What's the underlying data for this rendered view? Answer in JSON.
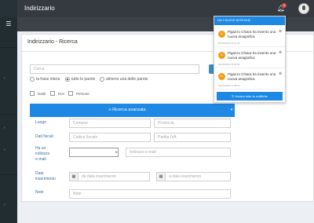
{
  "header": {
    "title": "Indirizzario",
    "bell_icon": "bell-icon",
    "bell_count": "3",
    "avatar_icon": "user-avatar"
  },
  "sidebar": {
    "menu_icon": "hamburger-icon",
    "chevrons": [
      "‹",
      "‹",
      "‹",
      "‹"
    ]
  },
  "panel": {
    "title": "Indirizzario - Ricerca",
    "search": {
      "placeholder": "Cerca"
    },
    "search_button_icon": "search-icon",
    "match_options": [
      {
        "label": "la frase intera",
        "checked": false
      },
      {
        "label": "tutte le parole",
        "checked": true
      },
      {
        "label": "almeno una delle parole",
        "checked": false
      }
    ],
    "checkboxes": [
      {
        "label": "Datiti",
        "checked": false
      },
      {
        "label": "Enti",
        "checked": false
      },
      {
        "label": "Persone",
        "checked": false
      }
    ],
    "advanced": {
      "label": "≡ Ricerca avanzata",
      "caret": "▾"
    }
  },
  "advanced_form": {
    "luogo": {
      "label": "Luogo",
      "comune_placeholder": "Comune",
      "provincia_placeholder": "Provincia"
    },
    "dati_fiscali": {
      "label": "Dati fiscali",
      "cf_placeholder": "Codice fiscale",
      "piva_placeholder": "Partita IVA"
    },
    "email": {
      "label_lines": [
        "Ha un",
        "indirizzo",
        "e-mail"
      ],
      "placeholder": "Indirizzo e-mail"
    },
    "data_inserimento": {
      "label_lines": [
        "Data",
        "inserimento"
      ],
      "from_placeholder": "da data inserimento",
      "to_placeholder": "a data inserimento",
      "calendar_icon": "calendar-icon"
    },
    "note": {
      "label": "Note",
      "placeholder": "Note"
    }
  },
  "notifications": {
    "header": "HAI 3 NUOVE NOTIFICHE",
    "items": [
      {
        "text": "Pigazzo Chiara ha inserito una nuova anagrafica",
        "time": "15/12/2015 15:11:18"
      },
      {
        "text": "Pigazzo Chiara ha inserito una nuova anagrafica",
        "time": "15/12/2015 15:09:06"
      },
      {
        "text": "Pigazzo Chiara ha inserito una nuova anagrafica",
        "time": "15/12/2015 14:58:53"
      }
    ],
    "footer": "↻ Mostra tutte le notifiche"
  },
  "colors": {
    "primary": "#1e88e5",
    "topbar": "#343a40",
    "sidebar": "#222d32",
    "badge": "#dd4b39",
    "notif_icon": "#f39c12"
  }
}
